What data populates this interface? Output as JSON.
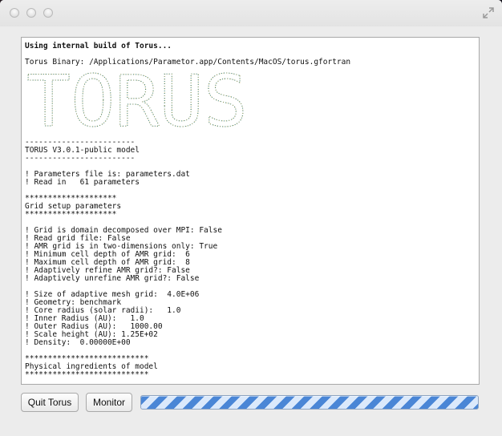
{
  "window": {
    "icons": {
      "close": "circle",
      "minimize": "circle",
      "zoom": "circle",
      "fullscreen": "fullscreen-arrows-icon"
    }
  },
  "console": {
    "header": "Using internal build of Torus...",
    "binary_line": "Torus Binary: /Applications/Parametor.app/Contents/MacOS/torus.gfortran",
    "banner_logo": "TORUS",
    "lines": [
      "------------------------",
      "TORUS V3.0.1-public model",
      "------------------------",
      "",
      "! Parameters file is: parameters.dat",
      "! Read in   61 parameters",
      "",
      "********************",
      "Grid setup parameters",
      "********************",
      "",
      "! Grid is domain decomposed over MPI: False",
      "! Read grid file: False",
      "! AMR grid is in two-dimensions only: True",
      "! Minimum cell depth of AMR grid:  6",
      "! Maximum cell depth of AMR grid:  8",
      "! Adaptively refine AMR grid?: False",
      "! Adaptively unrefine AMR grid?: False",
      "",
      "! Size of adaptive mesh grid:  4.0E+06",
      "! Geometry: benchmark",
      "! Core radius (solar radii):   1.0",
      "! Inner Radius (AU):   1.0",
      "! Outer Radius (AU):   1000.00",
      "! Scale height (AU): 1.25E+02",
      "! Density:  0.00000E+00",
      "",
      "***************************",
      "Physical ingredients of model",
      "***************************"
    ]
  },
  "buttons": {
    "quit": "Quit Torus",
    "monitor": "Monitor"
  },
  "progress": {
    "state": "indeterminate"
  },
  "colors": {
    "progress_stripe": "#4a86d6",
    "banner": "#2a6a55"
  }
}
